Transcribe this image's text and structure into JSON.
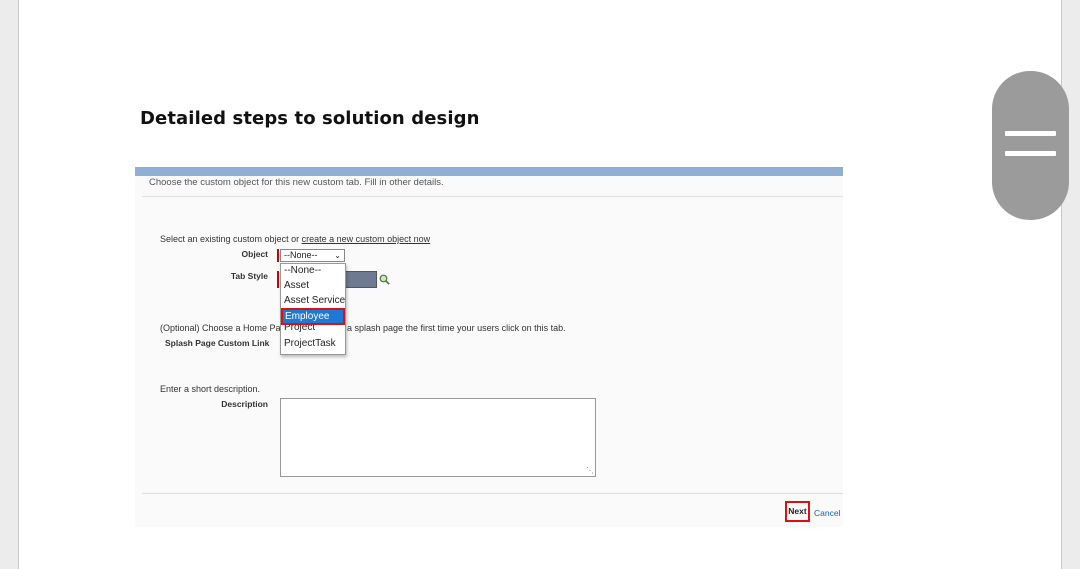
{
  "heading": "Detailed steps to solution design",
  "screenshot": {
    "instruction": "Choose the custom object for this new custom tab. Fill in other details.",
    "select_prefix": "Select an existing custom object or",
    "create_link": "create a new custom object now",
    "object_label": "Object",
    "object_value": "--None--",
    "tab_style_label": "Tab Style",
    "options": [
      "--None--",
      "Asset",
      "Asset Service",
      "Employee",
      "Project",
      "ProjectTask"
    ],
    "selected_option": "Employee",
    "splash_prefix": "(Optional) Choose a Home Page Cus",
    "splash_suffix": "a splash page the first time your users click on this tab.",
    "splash_label": "Splash Page Custom Link",
    "description_prompt": "Enter a short description.",
    "description_label": "Description",
    "next_label": "Next",
    "cancel_label": "Cancel"
  },
  "colors": {
    "highlight_border": "#d11111",
    "selected_bg": "#1e78d4",
    "header_bar": "#8fb0d4",
    "scroll_pill": "#9b9b9b"
  },
  "icons": {
    "scroll": "hamburger-icon",
    "lookup": "lookup-icon",
    "dropdown": "chevron-down-icon"
  }
}
